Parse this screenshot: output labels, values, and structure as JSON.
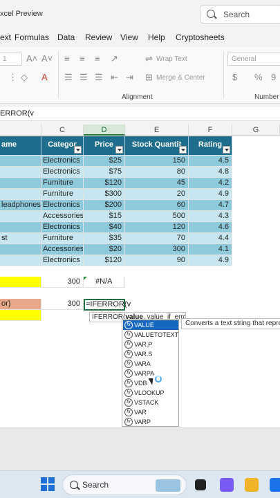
{
  "window": {
    "title": "xcel Preview"
  },
  "search": {
    "placeholder": "Search"
  },
  "menu": [
    "ext",
    "Formulas",
    "Data",
    "Review",
    "View",
    "Help",
    "Cryptosheets"
  ],
  "ribbon": {
    "font_size": "1",
    "wrap_text": "Wrap Text",
    "merge_center": "Merge & Center",
    "number_format": "General",
    "group_alignment": "Alignment",
    "group_number": "Number"
  },
  "formula_bar": {
    "content": "ERROR(v"
  },
  "columns": [
    {
      "id": "B",
      "label": ""
    },
    {
      "id": "C",
      "label": "C"
    },
    {
      "id": "D",
      "label": "D"
    },
    {
      "id": "E",
      "label": "E"
    },
    {
      "id": "F",
      "label": "F"
    },
    {
      "id": "G",
      "label": "G"
    }
  ],
  "table": {
    "headers": [
      "ame",
      "Categor",
      "Price",
      "Stock Quantit",
      "Rating"
    ],
    "rows": [
      [
        "",
        "Electronics",
        "$25",
        "150",
        "4.5"
      ],
      [
        "",
        "Electronics",
        "$75",
        "80",
        "4.8"
      ],
      [
        "",
        "Furniture",
        "$120",
        "45",
        "4.2"
      ],
      [
        "",
        "Furniture",
        "$300",
        "20",
        "4.9"
      ],
      [
        "leadphones",
        "Electronics",
        "$200",
        "60",
        "4.7"
      ],
      [
        "",
        "Accessories",
        "$15",
        "500",
        "4.3"
      ],
      [
        "",
        "Electronics",
        "$40",
        "120",
        "4.6"
      ],
      [
        "st",
        "Furniture",
        "$35",
        "70",
        "4.4"
      ],
      [
        "",
        "Accessories",
        "$20",
        "300",
        "4.1"
      ],
      [
        "",
        "Electronics",
        "$120",
        "90",
        "4.9"
      ]
    ]
  },
  "extra": {
    "row1_c": "300",
    "row1_d": "#N/A",
    "row2_b": "or)",
    "row2_c": "300",
    "formula_input": "=IFERROR(v"
  },
  "tooltip": {
    "fn": "IFERROR(",
    "arg": "value",
    "rest": ", value_if_error)"
  },
  "autocomplete": [
    "VALUE",
    "VALUETOTEXT",
    "VAR.P",
    "VAR.S",
    "VARA",
    "VARPA",
    "VDB",
    "VLOOKUP",
    "VSTACK",
    "VAR",
    "VARP"
  ],
  "autocomplete_desc": "Converts a text string that repre",
  "taskbar": {
    "search": "Search"
  }
}
